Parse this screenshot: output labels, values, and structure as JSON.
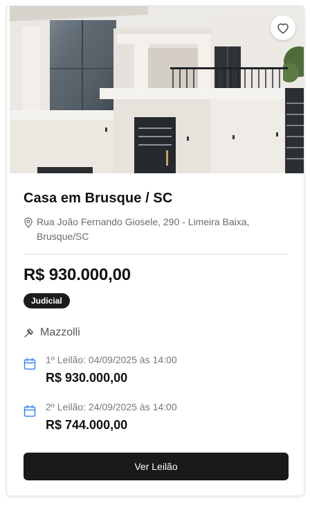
{
  "listing": {
    "title": "Casa em Brusque / SC",
    "address": "Rua João Fernando Giosele, 290 - Limeira Baixa, Brusque/SC",
    "price": "R$ 930.000,00",
    "badge": "Judicial",
    "auctioneer": "Mazzolli",
    "rounds": [
      {
        "label": "1º Leilão: 04/09/2025 às 14:00",
        "value": "R$ 930.000,00"
      },
      {
        "label": "2º Leilão: 24/09/2025 às 14:00",
        "value": "R$ 744.000,00"
      }
    ],
    "cta_label": "Ver Leilão"
  },
  "icons": {
    "favorite": "heart-icon",
    "location": "map-pin-icon",
    "auctioneer": "gavel-icon",
    "date": "calendar-icon"
  },
  "colors": {
    "primary_dark": "#1a1a1a",
    "calendar_accent": "#3b82f6",
    "muted_text": "#6b6b6b"
  }
}
